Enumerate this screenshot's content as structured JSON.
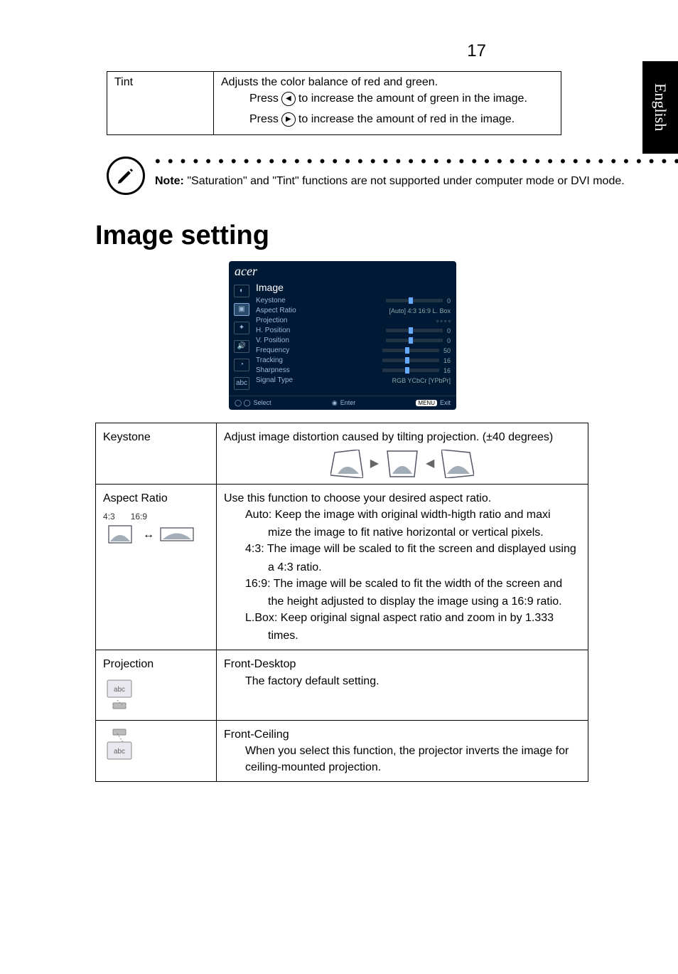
{
  "page_number": "17",
  "side_tab": "English",
  "tint_table": {
    "label": "Tint",
    "desc": "Adjusts the color balance of red and green.",
    "line_left_pre": "Press ",
    "line_left_post": " to increase the amount of green in the image.",
    "line_right_pre": "Press ",
    "line_right_post": " to increase the amount of red in the image."
  },
  "note": {
    "bold": "Note:",
    "text": "  \"Saturation\" and \"Tint\" functions are not supported under computer mode or DVI mode."
  },
  "section_heading": "Image setting",
  "osd": {
    "brand": "acer",
    "title": "Image",
    "rows": {
      "keystone": {
        "lbl": "Keystone",
        "val": "0"
      },
      "aspect": {
        "lbl": "Aspect Ratio",
        "opts": "[Auto]    4:3    16:9    L. Box"
      },
      "projection": {
        "lbl": "Projection"
      },
      "hpos": {
        "lbl": "H. Position",
        "val": "0"
      },
      "vpos": {
        "lbl": "V. Position",
        "val": "0"
      },
      "freq": {
        "lbl": "Frequency",
        "val": "50"
      },
      "track": {
        "lbl": "Tracking",
        "val": "16"
      },
      "sharp": {
        "lbl": "Sharpness",
        "val": "16"
      },
      "signal": {
        "lbl": "Signal Type",
        "opts": "RGB        YCbCr      [YPbPr]"
      }
    },
    "footer": {
      "select": "Select",
      "enter": "Enter",
      "menu": "MENU",
      "exit": "Exit"
    }
  },
  "main_table": {
    "keystone": {
      "label": "Keystone",
      "desc": "Adjust image distortion caused by tilting projection. (±40 degrees)"
    },
    "aspect": {
      "label": "Aspect Ratio",
      "r43": "4:3",
      "r169": "16:9",
      "desc": "Use this function to choose your desired aspect ratio.",
      "auto1": "Auto: Keep the image with original width-higth ratio and maxi",
      "auto2": "mize the image to fit native horizontal or vertical pixels.",
      "p43_1": "4:3: The image will be scaled to fit the screen and displayed using",
      "p43_2": "a 4:3 ratio.",
      "p169_1": "16:9: The  image will be scaled to fit the width of the screen and",
      "p169_2": "the height adjusted to display the image using a 16:9 ratio.",
      "lbox1": "L.Box: Keep original signal aspect ratio and zoom in by 1.333",
      "lbox2": "times."
    },
    "projection": {
      "label": "Projection",
      "fd": "Front-Desktop",
      "fd_desc": "The factory default setting.",
      "fc": "Front-Ceiling",
      "fc_desc": "When you select this function, the projector inverts the image for ceiling-mounted projection."
    }
  }
}
